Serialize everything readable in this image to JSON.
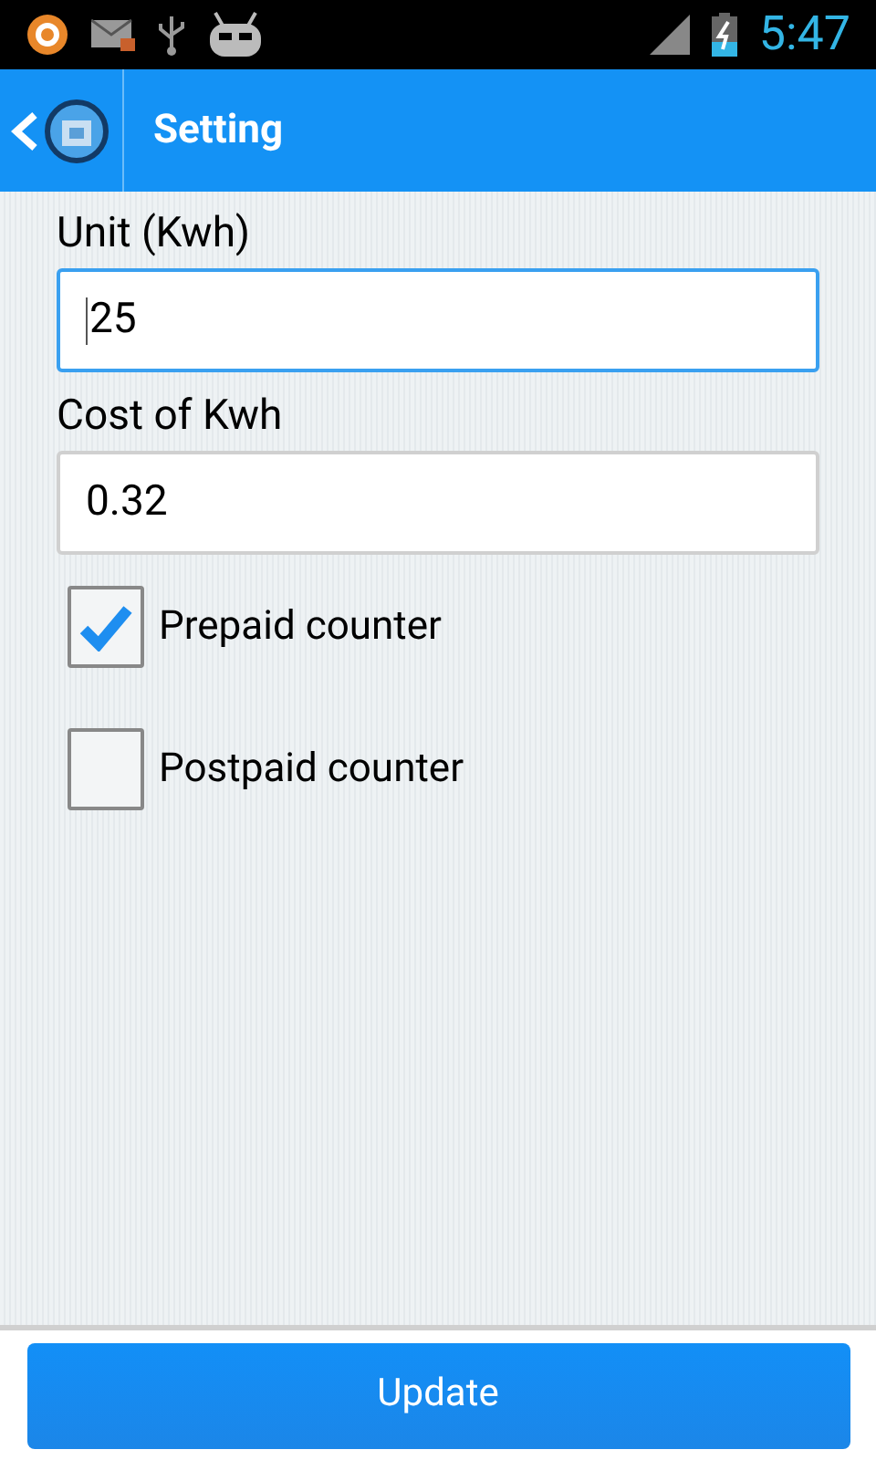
{
  "status_bar": {
    "time": "5:47"
  },
  "app_bar": {
    "title": "Setting"
  },
  "fields": [
    {
      "label": "Unit (Kwh)",
      "value": "25",
      "focused": true
    },
    {
      "label": "Cost of Kwh",
      "value": "0.32",
      "focused": false
    }
  ],
  "options": [
    {
      "label": "Prepaid counter",
      "checked": true
    },
    {
      "label": "Postpaid counter",
      "checked": false
    }
  ],
  "button": "Update"
}
